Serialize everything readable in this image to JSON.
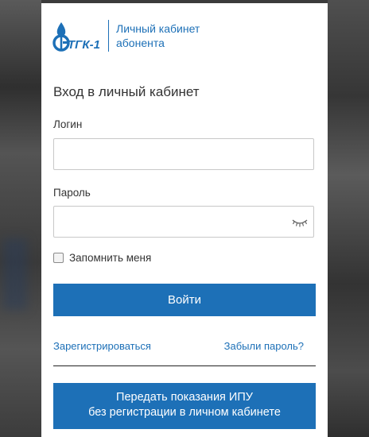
{
  "brand": {
    "logo_text": "ТГК-1",
    "caption_line1": "Личный кабинет",
    "caption_line2": "абонента",
    "accent_color": "#1d70b7"
  },
  "form": {
    "title": "Вход в личный кабинет",
    "login_label": "Логин",
    "login_value": "",
    "password_label": "Пароль",
    "password_value": "",
    "password_toggle_icon": "eye-closed-icon",
    "remember_label": "Запомнить меня",
    "remember_checked": false,
    "submit_label": "Войти"
  },
  "links": {
    "register": "Зарегистрироваться",
    "forgot_password": "Забыли пароль?"
  },
  "ipu_button": {
    "line1": "Передать показания ИПУ",
    "line2": "без регистрации в личном кабинете"
  }
}
